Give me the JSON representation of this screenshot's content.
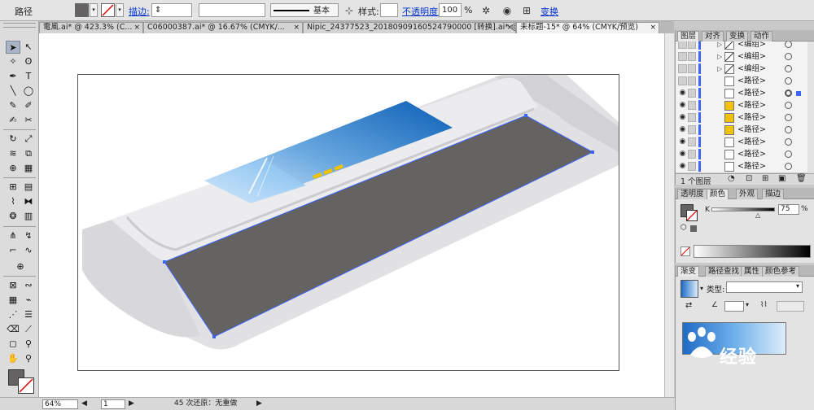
{
  "control_bar": {
    "object_type": "路径",
    "stroke_label": "描边:",
    "stroke_style": "基本",
    "style_label": "样式:",
    "opacity_label": "不透明度:",
    "opacity_value": "100",
    "percent": "%",
    "transform_label": "变换"
  },
  "doc_tabs": [
    {
      "label": "電風.ai* @ 423.3% (C..."
    },
    {
      "label": "C06000387.ai* @ 16.67% (CMYK/..."
    },
    {
      "label": "Nipic_24377523_20180909160524790000 [转换].ai* @ ..."
    },
    {
      "label": "未标题-15* @ 64% (CMYK/预览)"
    }
  ],
  "layers_panel": {
    "tabs": [
      "图层",
      "对齐",
      "变换",
      "动作"
    ],
    "rows": [
      {
        "name": "<编组>",
        "group": true,
        "eye": false
      },
      {
        "name": "<编组>",
        "group": true,
        "eye": false
      },
      {
        "name": "<编组>",
        "group": true,
        "eye": false
      },
      {
        "name": "<路径>",
        "group": false,
        "eye": false
      },
      {
        "name": "<路径>",
        "group": false,
        "eye": true,
        "selected": true
      },
      {
        "name": "<路径>",
        "group": false,
        "eye": true,
        "yellow": true
      },
      {
        "name": "<路径>",
        "group": false,
        "eye": true,
        "yellow": true
      },
      {
        "name": "<路径>",
        "group": false,
        "eye": true,
        "yellow": true
      },
      {
        "name": "<路径>",
        "group": false,
        "eye": true
      },
      {
        "name": "<路径>",
        "group": false,
        "eye": true
      },
      {
        "name": "<路径>",
        "group": false,
        "eye": true
      }
    ],
    "footer": "1 个图层"
  },
  "color_panel": {
    "tabs": [
      "透明度",
      "颜色",
      "外观",
      "描边"
    ],
    "channel_label": "K",
    "channel_value": "75",
    "fill_color": "#656262"
  },
  "gradient_panel": {
    "tabs": [
      "渐变",
      "路径查找",
      "属性",
      "颜色参考"
    ],
    "type_label": "类型:"
  },
  "status_bar": {
    "zoom": "64%",
    "artboard": "1",
    "message": "45 次还原：无重做"
  },
  "watermark": "经验",
  "colors": {
    "panel_blue": "#1e6bc5",
    "dark_panel": "#656262",
    "body_grey": "#e1e1e3",
    "selection": "#3c64ff",
    "yellow": "#f2c200"
  }
}
